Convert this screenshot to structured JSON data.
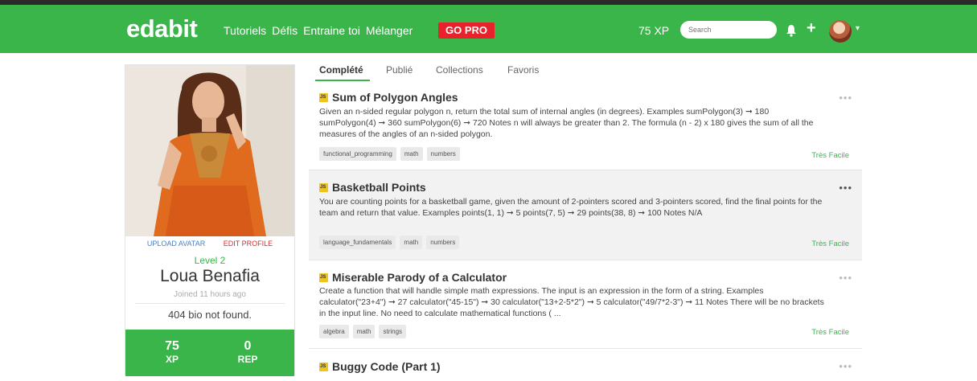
{
  "nav": {
    "logo": "edabit",
    "links": [
      "Tutoriels",
      "Défis",
      "Entraine toi",
      "Mélanger"
    ],
    "go_pro": "GO PRO",
    "xp": "75 XP",
    "search_placeholder": "Search",
    "plus": "+",
    "caret": "▾"
  },
  "profile": {
    "upload_avatar": "UPLOAD AVATAR",
    "edit_profile": "EDIT PROFILE",
    "level": "Level 2",
    "name": "Loua Benafia",
    "joined": "Joined 11 hours ago",
    "bio": "404 bio not found.",
    "stats": [
      {
        "value": "75",
        "label": "XP"
      },
      {
        "value": "0",
        "label": "REP"
      }
    ]
  },
  "tabs": [
    "Complété",
    "Publié",
    "Collections",
    "Favoris"
  ],
  "challenges": [
    {
      "lang_badge": "JS",
      "title": "Sum of Polygon Angles",
      "description": "Given an n-sided regular polygon n, return the total sum of internal angles (in degrees). Examples sumPolygon(3) ➞ 180 sumPolygon(4) ➞ 360 sumPolygon(6) ➞ 720 Notes n will always be greater than 2. The formula (n - 2) x 180 gives the sum of all the measures of the angles of an n-sided polygon.",
      "tags": [
        "functional_programming",
        "math",
        "numbers"
      ],
      "difficulty": "Très Facile",
      "menu": "•••"
    },
    {
      "lang_badge": "JS",
      "title": "Basketball Points",
      "description": "You are counting points for a basketball game, given the amount of 2-pointers scored and 3-pointers scored, find the final points for the team and return that value. Examples points(1, 1) ➞ 5 points(7, 5) ➞ 29 points(38, 8) ➞ 100 Notes N/A",
      "tags": [
        "language_fundamentals",
        "math",
        "numbers"
      ],
      "difficulty": "Très Facile",
      "menu": "•••"
    },
    {
      "lang_badge": "JS",
      "title": "Miserable Parody of a Calculator",
      "description": "Create a function that will handle simple math expressions. The input is an expression in the form of a string. Examples calculator(\"23+4\") ➞ 27 calculator(\"45-15\") ➞ 30 calculator(\"13+2-5*2\") ➞ 5 calculator(\"49/7*2-3\") ➞ 11 Notes There will be no brackets in the input line. No need to calculate mathematical functions ( ...",
      "tags": [
        "algebra",
        "math",
        "strings"
      ],
      "difficulty": "Très Facile",
      "menu": "•••"
    },
    {
      "lang_badge": "JS",
      "title": "Buggy Code (Part 1)",
      "menu": "•••"
    }
  ]
}
